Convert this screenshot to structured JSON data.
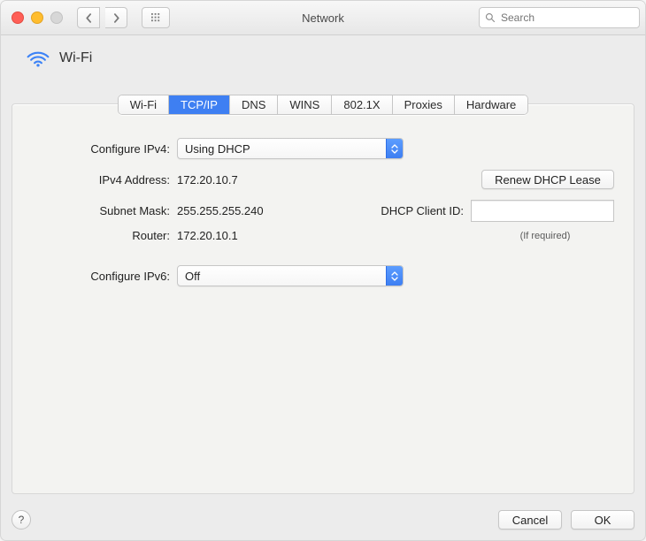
{
  "window": {
    "title": "Network"
  },
  "toolbar": {
    "search_placeholder": "Search"
  },
  "header": {
    "service_name": "Wi-Fi"
  },
  "tabs": {
    "items": [
      "Wi-Fi",
      "TCP/IP",
      "DNS",
      "WINS",
      "802.1X",
      "Proxies",
      "Hardware"
    ],
    "active_index": 1
  },
  "ipv4": {
    "configure_label": "Configure IPv4:",
    "configure_value": "Using DHCP",
    "address_label": "IPv4 Address:",
    "address_value": "172.20.10.7",
    "subnet_label": "Subnet Mask:",
    "subnet_value": "255.255.255.240",
    "router_label": "Router:",
    "router_value": "172.20.10.1",
    "renew_button": "Renew DHCP Lease",
    "client_id_label": "DHCP Client ID:",
    "client_id_value": "",
    "client_id_hint": "(If required)"
  },
  "ipv6": {
    "configure_label": "Configure IPv6:",
    "configure_value": "Off"
  },
  "footer": {
    "help": "?",
    "cancel": "Cancel",
    "ok": "OK"
  }
}
